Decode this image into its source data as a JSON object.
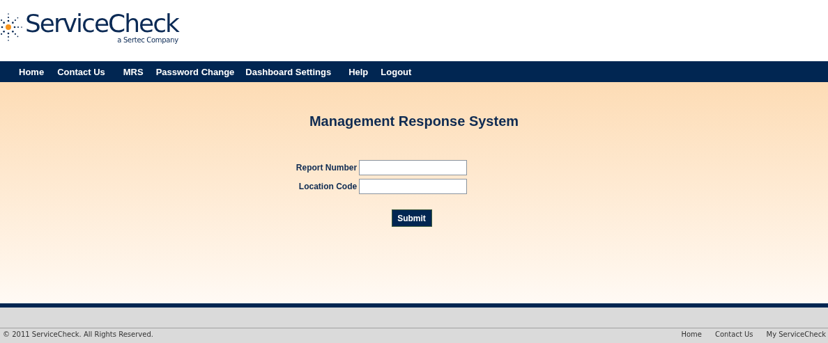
{
  "logo": {
    "name": "ServiceCheck",
    "tagline": "a Sertec Company"
  },
  "nav": [
    "Home",
    "Contact Us",
    "MRS",
    "Password Change",
    "Dashboard Settings",
    "Help",
    "Logout"
  ],
  "title": "Management Response System",
  "fields": [
    {
      "label": "Report Number"
    },
    {
      "label": "Location Code"
    }
  ],
  "submit": "Submit",
  "footer": {
    "copyright": "© 2011 ServiceCheck. All Rights Reserved.",
    "links": [
      "Home",
      "Contact Us",
      "My ServiceCheck"
    ]
  }
}
